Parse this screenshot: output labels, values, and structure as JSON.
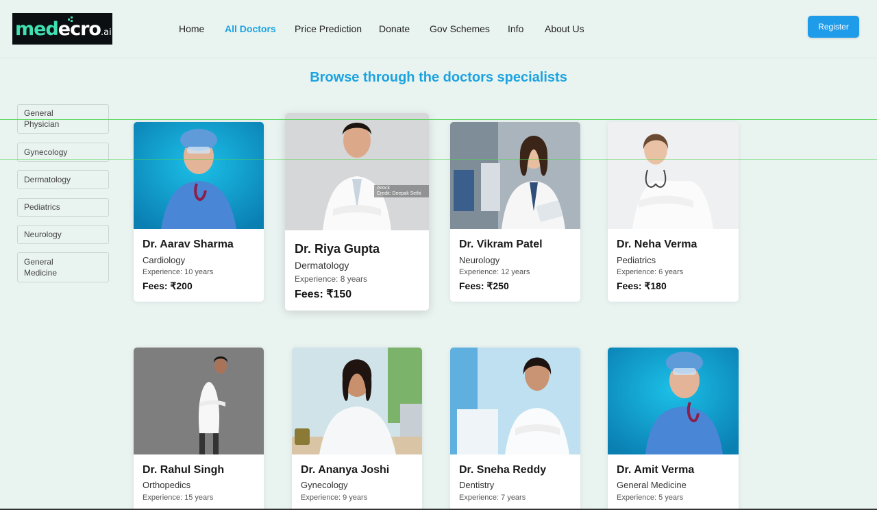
{
  "header": {
    "logo": {
      "part1": "med",
      "part2": "ecro",
      "suffix": ".ai"
    },
    "nav": [
      {
        "label": "Home",
        "active": false
      },
      {
        "label": "All Doctors",
        "active": true
      },
      {
        "label": "Price Prediction",
        "active": false
      },
      {
        "label": "Donate",
        "active": false
      },
      {
        "label": "Gov Schemes",
        "active": false
      },
      {
        "label": "Info",
        "active": false
      },
      {
        "label": "About Us",
        "active": false
      }
    ],
    "register_label": "Register"
  },
  "page_title": "Browse through the doctors specialists",
  "sidebar": {
    "items": [
      {
        "line1": "General",
        "line2": "Physician"
      },
      {
        "line1": "Gynecology",
        "line2": ""
      },
      {
        "line1": "Dermatology",
        "line2": ""
      },
      {
        "line1": "Pediatrics",
        "line2": ""
      },
      {
        "line1": "Neurology",
        "line2": ""
      },
      {
        "line1": "General",
        "line2": "Medicine"
      }
    ]
  },
  "doctors": [
    {
      "name": "Dr. Aarav Sharma",
      "specialty": "Cardiology",
      "experience": "Experience: 10 years",
      "fees": "Fees: ₹200"
    },
    {
      "name": "Dr. Riya Gupta",
      "specialty": "Dermatology",
      "experience": "Experience: 8 years",
      "fees": "Fees: ₹150",
      "watermark1": "iStock",
      "watermark2": "Credit: Deepak Sethi"
    },
    {
      "name": "Dr. Vikram Patel",
      "specialty": "Neurology",
      "experience": "Experience: 12 years",
      "fees": "Fees: ₹250"
    },
    {
      "name": "Dr. Neha Verma",
      "specialty": "Pediatrics",
      "experience": "Experience: 6 years",
      "fees": "Fees: ₹180"
    },
    {
      "name": "Dr. Rahul Singh",
      "specialty": "Orthopedics",
      "experience": "Experience: 15 years",
      "fees": ""
    },
    {
      "name": "Dr. Ananya Joshi",
      "specialty": "Gynecology",
      "experience": "Experience: 9 years",
      "fees": ""
    },
    {
      "name": "Dr. Sneha Reddy",
      "specialty": "Dentistry",
      "experience": "Experience: 7 years",
      "fees": ""
    },
    {
      "name": "Dr. Amit Verma",
      "specialty": "General Medicine",
      "experience": "Experience: 5 years",
      "fees": ""
    }
  ],
  "colors": {
    "accent": "#1ba3e0",
    "register_bg": "#1e9be9",
    "page_bg": "#e9f3f0",
    "logo_bg": "#0b0f12",
    "logo_green": "#3fe0b2"
  }
}
